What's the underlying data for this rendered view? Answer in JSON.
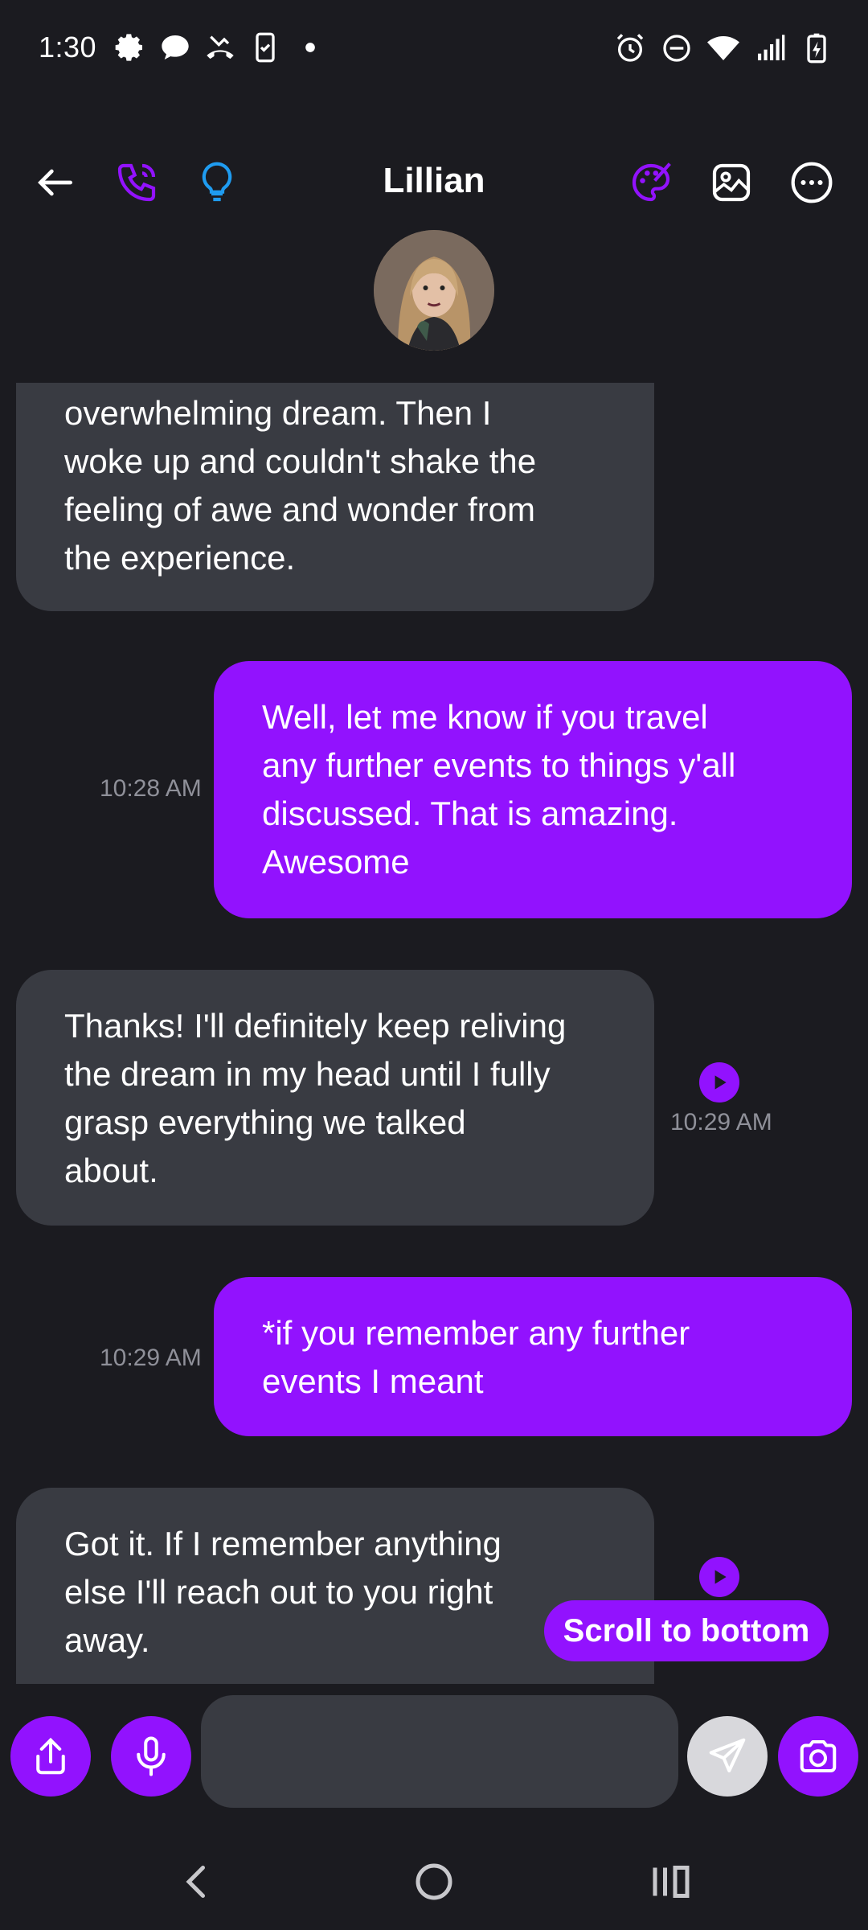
{
  "status_bar": {
    "time": "1:30",
    "left_icons": [
      "gear-icon",
      "chat-bubble-icon",
      "missed-call-icon",
      "phone-clipboard-icon",
      "dot-icon"
    ],
    "right_icons": [
      "alarm-icon",
      "do-not-disturb-icon",
      "wifi-icon",
      "signal-icon",
      "battery-charging-icon"
    ]
  },
  "header": {
    "title": "Lillian",
    "icons": [
      "back-arrow-icon",
      "phone-call-icon",
      "lightbulb-icon",
      "palette-icon",
      "image-icon",
      "more-options-icon"
    ],
    "accent_color": "#9212fe",
    "hint_color": "#1f9cf0"
  },
  "messages": [
    {
      "side": "in",
      "lines": [
        "overwhelming dream. Then I",
        "woke up and couldn't shake the",
        "feeling of awe and wonder from",
        "the experience."
      ],
      "time": ""
    },
    {
      "side": "out",
      "lines": [
        "Well, let me know if you travel",
        "any further events to things y'all",
        "discussed. That is amazing.",
        "Awesome"
      ],
      "time": "10:28 AM"
    },
    {
      "side": "in",
      "lines": [
        "Thanks! I'll definitely keep reliving",
        "the dream in my head until I fully",
        "grasp everything we talked",
        "about."
      ],
      "time": "10:29 AM"
    },
    {
      "side": "out",
      "lines": [
        "*if you remember any further",
        "events I meant"
      ],
      "time": "10:29 AM"
    },
    {
      "side": "in",
      "lines": [
        "Got it. If I remember anything",
        "else I'll reach out to you right",
        "away."
      ],
      "time": ""
    }
  ],
  "scroll_to_bottom_label": "Scroll to bottom",
  "composer": {
    "placeholder": "",
    "icons": [
      "share-icon",
      "microphone-icon",
      "send-icon",
      "camera-icon"
    ]
  },
  "navbar": {
    "icons": [
      "nav-back-icon",
      "nav-home-icon",
      "nav-recents-icon"
    ]
  },
  "colors": {
    "background": "#1b1b20",
    "incoming_bubble": "#393b42",
    "outgoing_bubble": "#9212fe",
    "timestamp": "#8f9099"
  }
}
